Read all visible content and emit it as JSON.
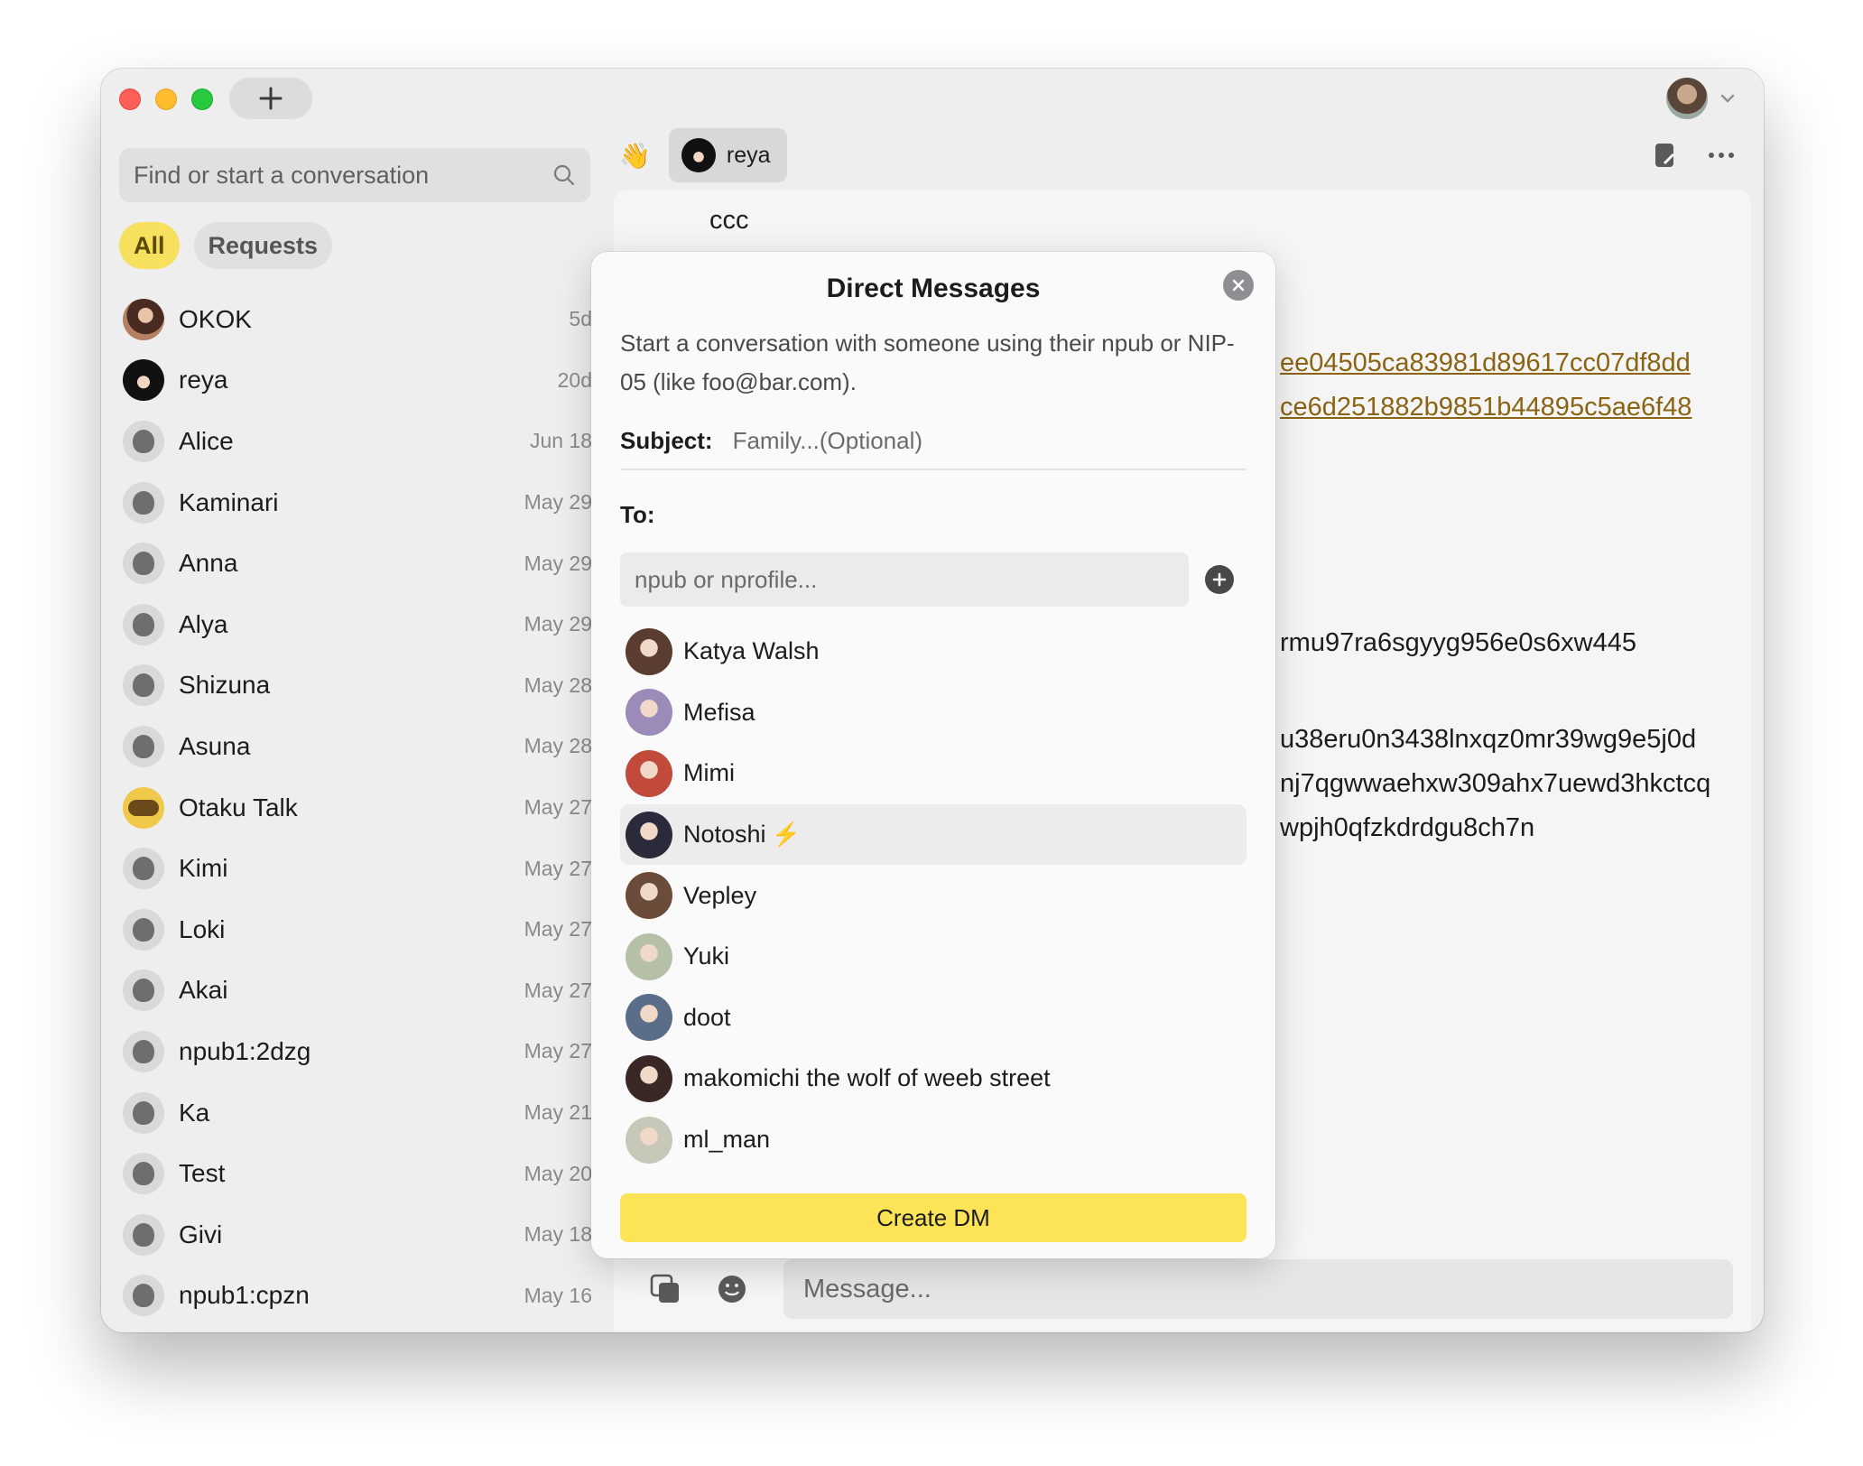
{
  "window": {
    "account_menu_icon": "chevron-down-icon"
  },
  "sidebar": {
    "search_placeholder": "Find or start a conversation",
    "filters": [
      "All",
      "Requests"
    ],
    "conversations": [
      {
        "name": "OKOK",
        "date": "5d",
        "avatar": "okok"
      },
      {
        "name": "reya",
        "date": "20d",
        "avatar": "reya"
      },
      {
        "name": "Alice",
        "date": "Jun 18",
        "avatar": "default"
      },
      {
        "name": "Kaminari",
        "date": "May 29",
        "avatar": "default"
      },
      {
        "name": "Anna",
        "date": "May 29",
        "avatar": "default"
      },
      {
        "name": "Alya",
        "date": "May 29",
        "avatar": "default"
      },
      {
        "name": "Shizuna",
        "date": "May 28",
        "avatar": "default"
      },
      {
        "name": "Asuna",
        "date": "May 28",
        "avatar": "default"
      },
      {
        "name": "Otaku Talk",
        "date": "May 27",
        "avatar": "otaku"
      },
      {
        "name": "Kimi",
        "date": "May 27",
        "avatar": "default"
      },
      {
        "name": "Loki",
        "date": "May 27",
        "avatar": "default"
      },
      {
        "name": "Akai",
        "date": "May 27",
        "avatar": "default"
      },
      {
        "name": "npub1:2dzg",
        "date": "May 27",
        "avatar": "default"
      },
      {
        "name": "Ka",
        "date": "May 21",
        "avatar": "default"
      },
      {
        "name": "Test",
        "date": "May 20",
        "avatar": "default"
      },
      {
        "name": "Givi",
        "date": "May 18",
        "avatar": "default"
      },
      {
        "name": "npub1:cpzn",
        "date": "May 16",
        "avatar": "default"
      }
    ]
  },
  "chat": {
    "wave_emoji": "👋",
    "participant": "reya",
    "background_lines": {
      "ccc": "ccc",
      "link1": "ee04505ca83981d89617cc07df8dd",
      "link2": "ce6d251882b9851b44895c5ae6f48",
      "text1": "rmu97ra6sgyyg956e0s6xw445",
      "text2": "u38eru0n3438lnxqz0mr39wg9e5j0d",
      "text3": "nj7qgwwaehxw309ahx7uewd3hkctcq",
      "text4": "wpjh0qfzkdrdgu8ch7n"
    },
    "message_placeholder": "Message..."
  },
  "modal": {
    "title": "Direct Messages",
    "description": "Start a conversation with someone using their npub or NIP-05 (like foo@bar.com).",
    "subject_label": "Subject:",
    "subject_placeholder": "Family...(Optional)",
    "to_label": "To:",
    "to_placeholder": "npub or nprofile...",
    "contacts": [
      {
        "name": "Katya Walsh",
        "color": "#5a3d30"
      },
      {
        "name": "Mefisa",
        "color": "#9b8bb8"
      },
      {
        "name": "Mimi",
        "color": "#c24a3a"
      },
      {
        "name": "Notoshi",
        "color": "#2a2a3a",
        "badge": "⚡"
      },
      {
        "name": "Vepley",
        "color": "#6b4b3a"
      },
      {
        "name": "Yuki",
        "color": "#b6c0a8"
      },
      {
        "name": "doot",
        "color": "#5a6e8a"
      },
      {
        "name": "makomichi the wolf of weeb street",
        "color": "#3a2826"
      },
      {
        "name": "ml_man",
        "color": "#c8c8b8"
      }
    ],
    "hovered_contact": "Notoshi",
    "create_label": "Create DM"
  },
  "colors": {
    "accent": "#fde456",
    "link": "#8a6412"
  }
}
